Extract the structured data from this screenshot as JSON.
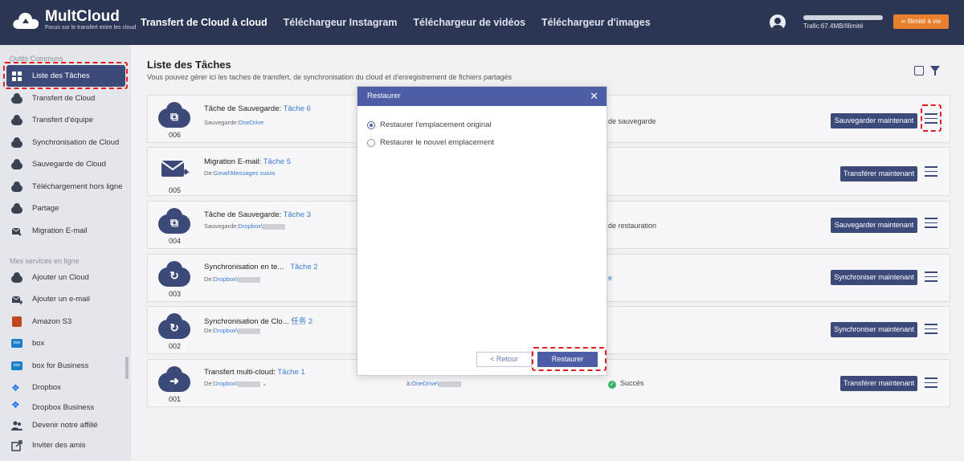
{
  "brand": {
    "name": "MultCloud",
    "tagline": "Focus sur le transfert entre les cloud"
  },
  "nav": {
    "tabs": [
      "Transfert de Cloud à cloud",
      "Téléchargeur Instagram",
      "Téléchargeur de vidéos",
      "Téléchargeur d'images"
    ],
    "active_tab": 0
  },
  "header": {
    "traffic": "Trafic:67.4MB/Illimité",
    "upgrade_label": "Illimité à vie"
  },
  "sidebar": {
    "section_common": "Outils Communs",
    "common_items": [
      "Liste des Tâches",
      "Transfert de Cloud",
      "Transfert d'équipe",
      "Synchronisation de Cloud",
      "Sauvegarde de Cloud",
      "Téléchargement hors ligne",
      "Partage",
      "Migration E-mail"
    ],
    "active_item": "Liste des Tâches",
    "section_services": "Mes services en ligne",
    "service_items": [
      "Ajouter un Cloud",
      "Ajouter un e-mail",
      "Amazon S3",
      "box",
      "box for Business",
      "Dropbox",
      "Dropbox Business"
    ],
    "bottom_items": [
      "Devenir notre affilié",
      "Inviter des amis"
    ]
  },
  "main": {
    "title": "Liste des Tâches",
    "subtitle": "Vous pouvez gérer ici les taches de transfert, de synchronisation du cloud et d'enregistrement de fichiers partagés"
  },
  "tasks": [
    {
      "num": "006",
      "type_label": "Tâche de Sauvegarde:",
      "name": "Tâche 6",
      "from_prefix": "Sauvegarde:",
      "from_cloud": "OneDrive",
      "to_prefix": "",
      "to_cloud": "",
      "status": "de sauvegarde",
      "status_is_link": false,
      "action": "Sauvegarder maintenant",
      "glyph": "⧉"
    },
    {
      "num": "005",
      "type_label": "Migration E-mail:",
      "name": "Tâche 5",
      "from_prefix": "De:",
      "from_cloud": "Gmail\\Messages suivis",
      "to_prefix": "",
      "to_cloud": "",
      "status": "",
      "status_is_link": false,
      "action": "Transférer maintenant",
      "glyph": "✉"
    },
    {
      "num": "004",
      "type_label": "Tâche de Sauvegarde:",
      "name": "Tâche 3",
      "from_prefix": "Sauvegarde:",
      "from_cloud": "Dropbox\\",
      "to_prefix": "",
      "to_cloud": "",
      "status": "de restauration",
      "status_is_link": false,
      "action": "Sauvegarder maintenant",
      "glyph": "⧉"
    },
    {
      "num": "003",
      "type_label": "Synchronisation en te...",
      "name": "Tâche 2",
      "from_prefix": "De:",
      "from_cloud": "Dropbox\\",
      "to_prefix": "",
      "to_cloud": "",
      "status": "e",
      "status_is_link": true,
      "action": "Synchroniser maintenant",
      "glyph": "↻"
    },
    {
      "num": "002",
      "type_label": "Synchronisation de Clo...",
      "name": "任务 2",
      "from_prefix": "De:",
      "from_cloud": "Dropbox\\",
      "to_prefix": "",
      "to_cloud": "",
      "status": "",
      "status_is_link": false,
      "action": "Synchroniser maintenant",
      "glyph": "↻"
    },
    {
      "num": "001",
      "type_label": "Transfert multi-cloud:",
      "name": "Tâche 1",
      "from_prefix": "De:",
      "from_cloud": "Dropbox\\",
      "to_prefix": "à:",
      "to_cloud": "OneDrive\\",
      "status": "Succès",
      "status_is_link": false,
      "action": "Transférer maintenant",
      "glyph": "➜"
    }
  ],
  "modal": {
    "title": "Restaurer",
    "options": [
      "Restaurer l'emplacement original",
      "Restaurer le nouvel emplacement"
    ],
    "selected_option": 0,
    "back_label": "< Retour",
    "confirm_label": "Restaurer"
  },
  "colors": {
    "topbar": "#2b3654",
    "accent": "#3c4a7a",
    "modal_accent": "#4d5ea6",
    "upgrade": "#e8802e",
    "highlight": "#e02020",
    "success": "#3db36b"
  }
}
